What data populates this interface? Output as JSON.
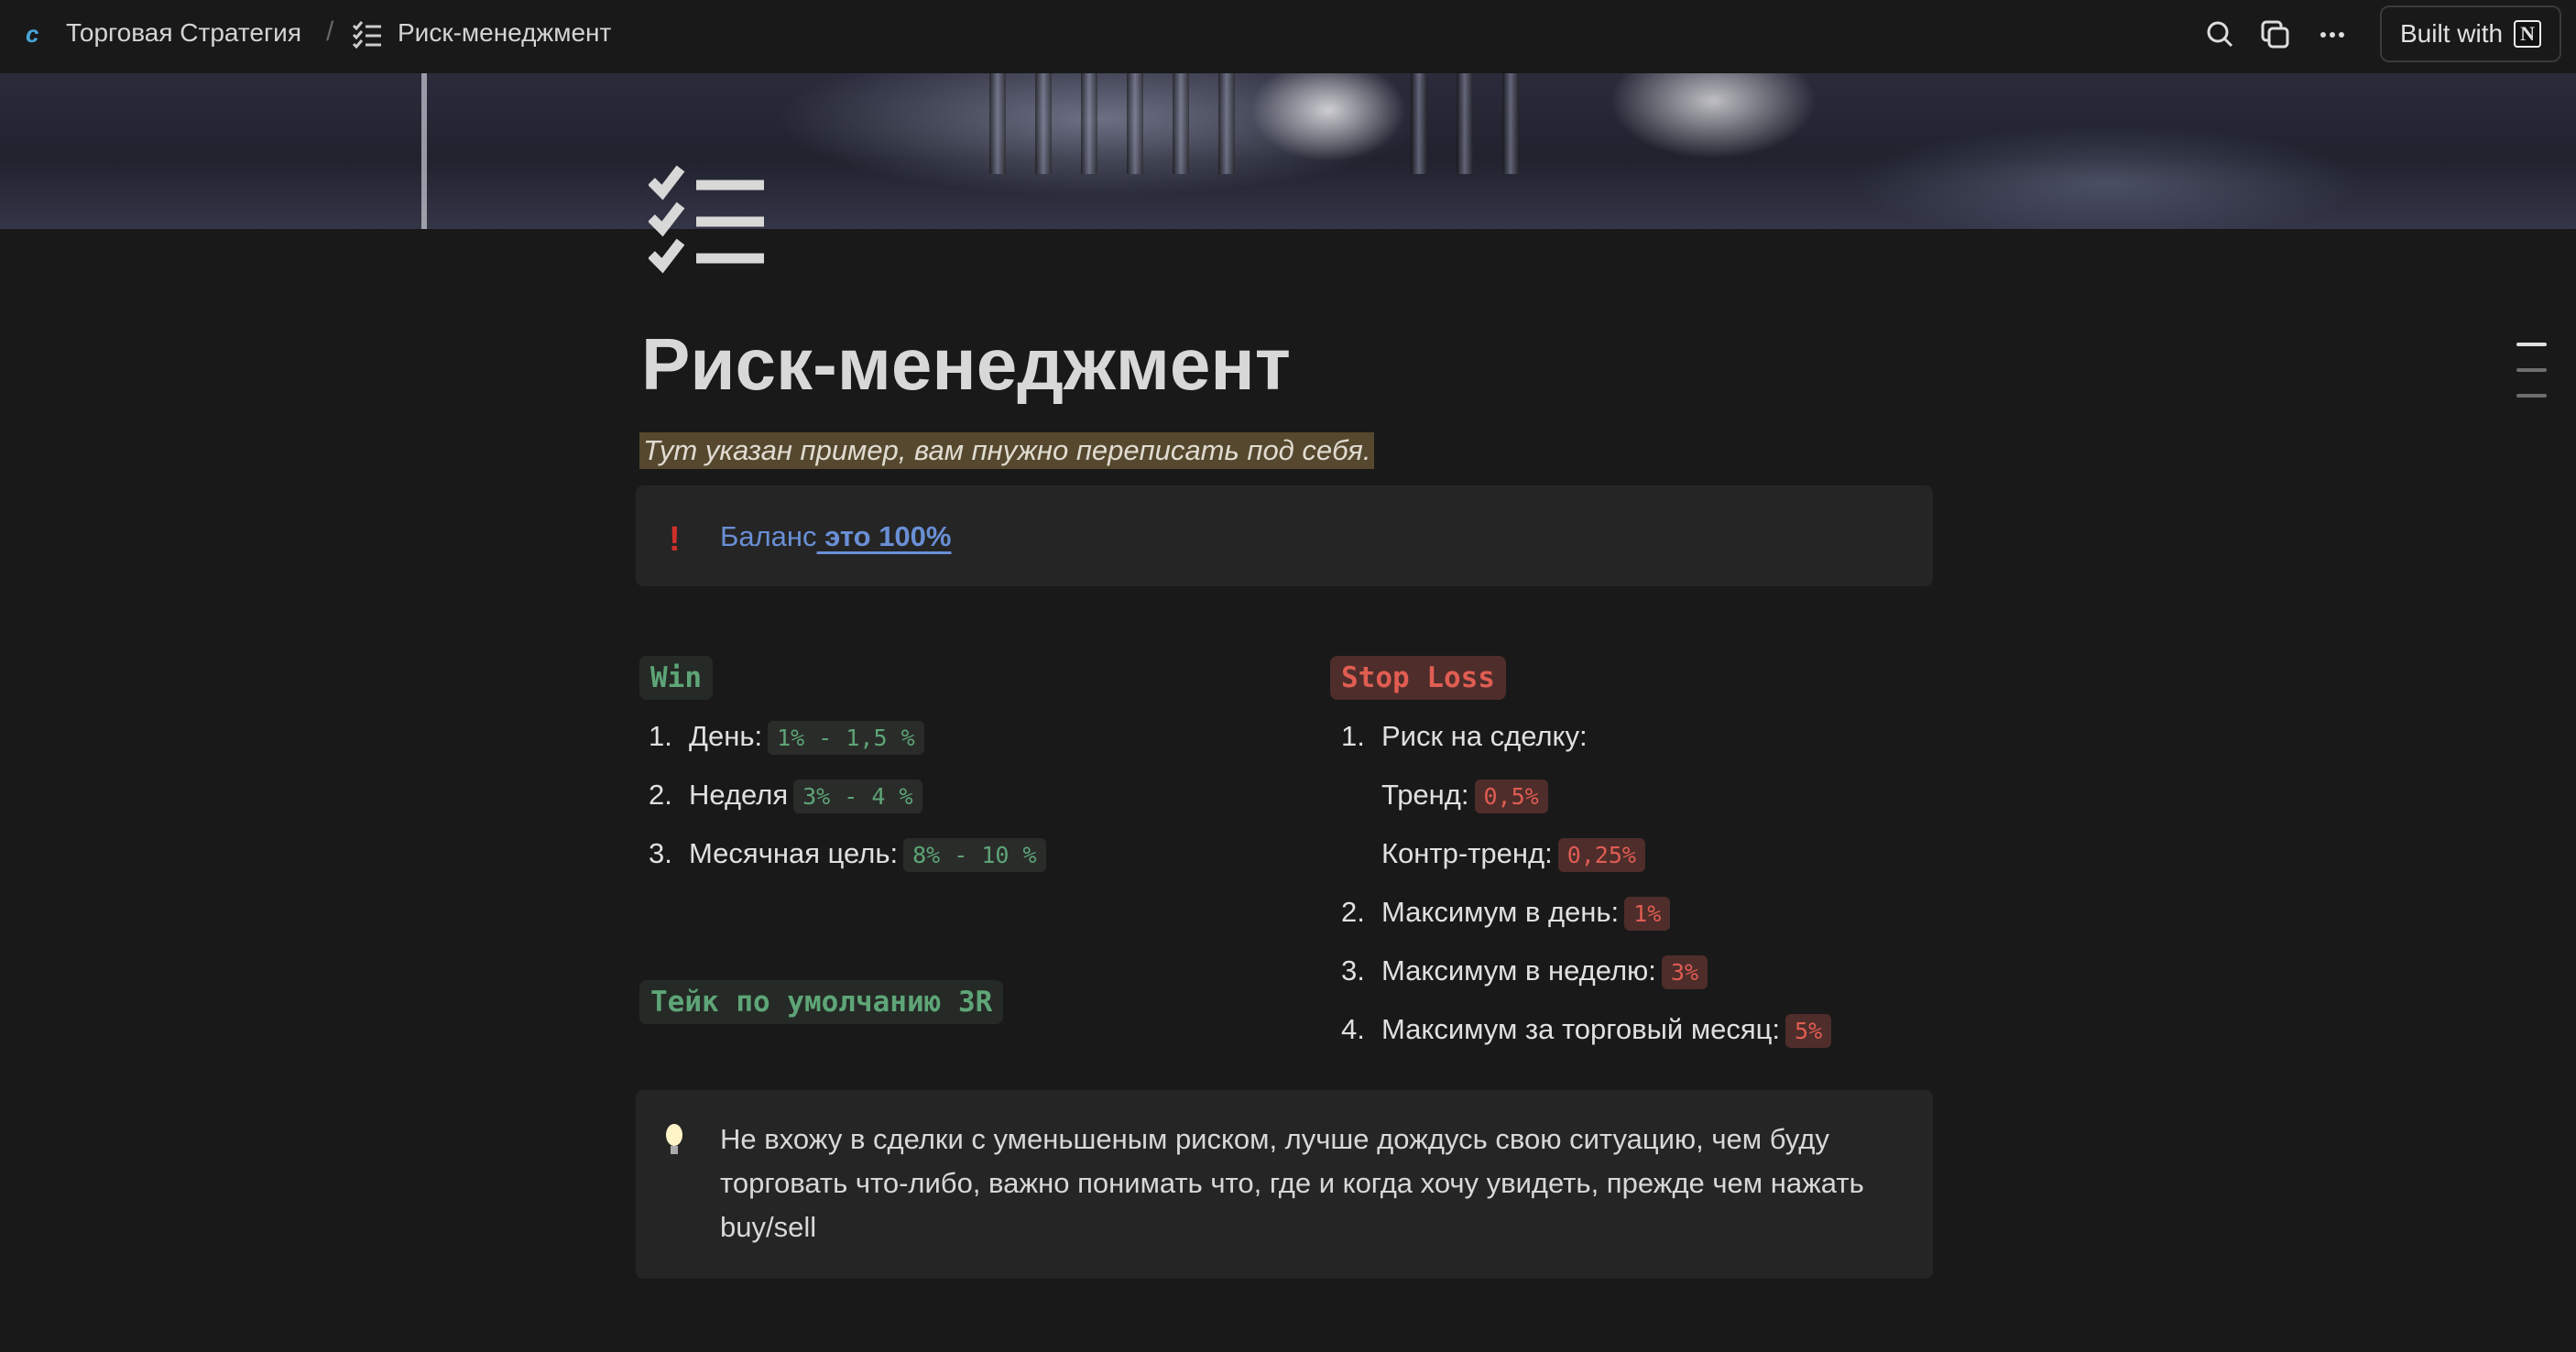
{
  "topbar": {
    "breadcrumb": [
      "Торговая Стратегия",
      "Риск-менеджмент"
    ],
    "separator": "/",
    "built_with": "Built with",
    "notion_letter": "N",
    "icons": [
      "search-icon",
      "duplicate-icon",
      "more-icon"
    ]
  },
  "page": {
    "title": "Риск-менеджмент",
    "icon": "checklist-icon",
    "subtitle": "Тут указан пример, вам пнужно переписать под себя.",
    "highlight_color": "#56482e"
  },
  "callout1": {
    "icon": "exclamation-icon",
    "text": "Баланс",
    "link": " это 100%"
  },
  "win": {
    "label": "Win",
    "items": [
      {
        "num": "1.",
        "text": "День:",
        "value": "1% - 1,5 %"
      },
      {
        "num": "2.",
        "text": "Неделя",
        "value": "3% - 4 %"
      },
      {
        "num": "3.",
        "text": "Месячная цель:",
        "value": "8% - 10 %"
      }
    ],
    "take_label": "Тейк по умолчанию 3R"
  },
  "stoploss": {
    "label": "Stop Loss",
    "items": [
      {
        "num": "1.",
        "text": "Риск на сделку:"
      },
      {
        "num": "",
        "text": "Тренд:",
        "value": "0,5%"
      },
      {
        "num": "",
        "text": "Контр-тренд:",
        "value": "0,25%"
      },
      {
        "num": "2.",
        "text": "Максимум в день:",
        "value": "1%"
      },
      {
        "num": "3.",
        "text": "Максимум в неделю:",
        "value": "3%"
      },
      {
        "num": "4.",
        "text": "Максимум за торговый месяц:",
        "value": "5%"
      }
    ]
  },
  "callout2": {
    "icon": "lightbulb-icon",
    "text": "Не вхожу в сделки с уменьшеным риском, лучше дождусь свою ситуацию, чем буду торговать что-либо, важно понимать что, где и когда хочу увидеть, прежде чем нажать buy/sell"
  },
  "colors": {
    "green": "#5ea577",
    "red": "#e05d52",
    "link": "#6a8fd6",
    "bg": "#191919"
  }
}
